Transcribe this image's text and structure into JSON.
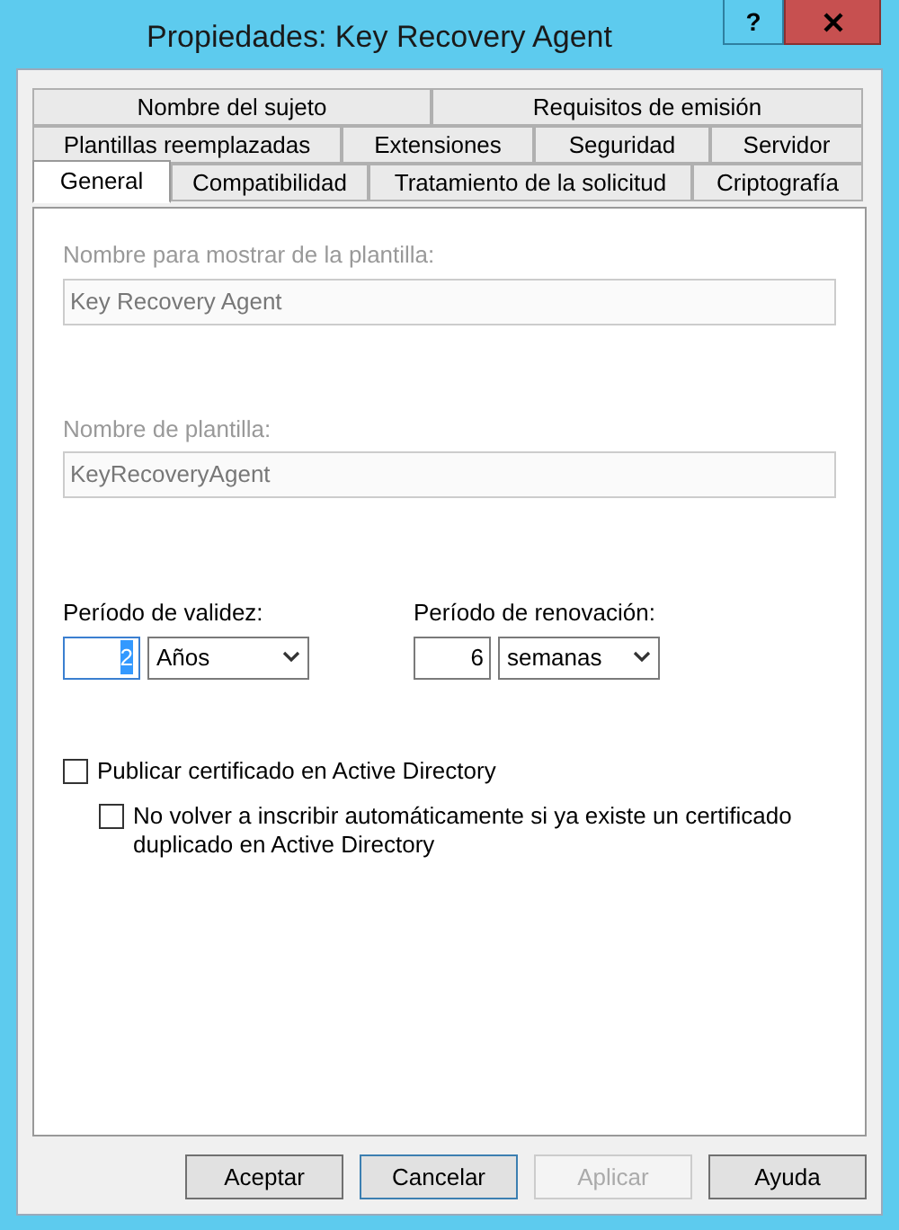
{
  "window": {
    "title": "Propiedades: Key Recovery Agent",
    "help": "?"
  },
  "tab_rows": [
    [
      {
        "label": "Nombre del sujeto",
        "selected": false
      },
      {
        "label": "Requisitos de emisión",
        "selected": false
      }
    ],
    [
      {
        "label": "Plantillas reemplazadas",
        "selected": false
      },
      {
        "label": "Extensiones",
        "selected": false
      },
      {
        "label": "Seguridad",
        "selected": false
      },
      {
        "label": "Servidor",
        "selected": false
      }
    ],
    [
      {
        "label": "General",
        "selected": true
      },
      {
        "label": "Compatibilidad",
        "selected": false
      },
      {
        "label": "Tratamiento de la solicitud",
        "selected": false
      },
      {
        "label": "Criptografía",
        "selected": false
      }
    ]
  ],
  "text_fields": [
    {
      "label": "Nombre para mostrar de la plantilla:",
      "value": "Key Recovery Agent",
      "disabled": true
    },
    {
      "label": "Nombre de plantilla:",
      "value": "KeyRecoveryAgent",
      "disabled": true
    }
  ],
  "periods": [
    {
      "label": "Período de validez:",
      "number": "2",
      "highlighted": true,
      "unit": "Años"
    },
    {
      "label": "Período de renovación:",
      "number": "6",
      "highlighted": false,
      "unit": "semanas"
    }
  ],
  "checkboxes": [
    {
      "label": "Publicar certificado en Active Directory",
      "checked": false,
      "children": [
        {
          "label": "No volver a inscribir automáticamente si ya existe un certificado duplicado en Active Directory",
          "checked": false
        }
      ]
    }
  ],
  "buttons": [
    {
      "label": "Aceptar",
      "disabled": false,
      "focused": false
    },
    {
      "label": "Cancelar",
      "disabled": false,
      "focused": true
    },
    {
      "label": "Aplicar",
      "disabled": true,
      "focused": false
    },
    {
      "label": "Ayuda",
      "disabled": false,
      "focused": false
    }
  ]
}
